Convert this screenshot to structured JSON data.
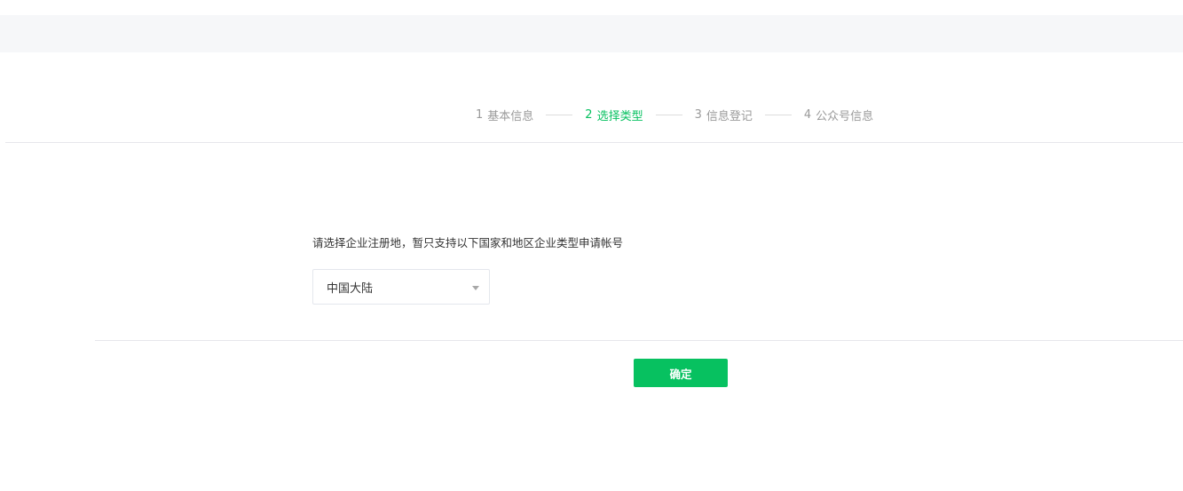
{
  "steps": [
    {
      "num": "1",
      "label": "基本信息",
      "state": "done"
    },
    {
      "num": "2",
      "label": "选择类型",
      "state": "active"
    },
    {
      "num": "3",
      "label": "信息登记",
      "state": "pending"
    },
    {
      "num": "4",
      "label": "公众号信息",
      "state": "pending"
    }
  ],
  "form": {
    "instruction": "请选择企业注册地，暂只支持以下国家和地区企业类型申请帐号",
    "region_select": {
      "value": "中国大陆",
      "icon": "chevron-down-icon"
    },
    "confirm_label": "确定"
  },
  "colors": {
    "accent": "#07c160",
    "step_inactive": "#9a9a9a",
    "band_background": "#f6f7f9"
  }
}
